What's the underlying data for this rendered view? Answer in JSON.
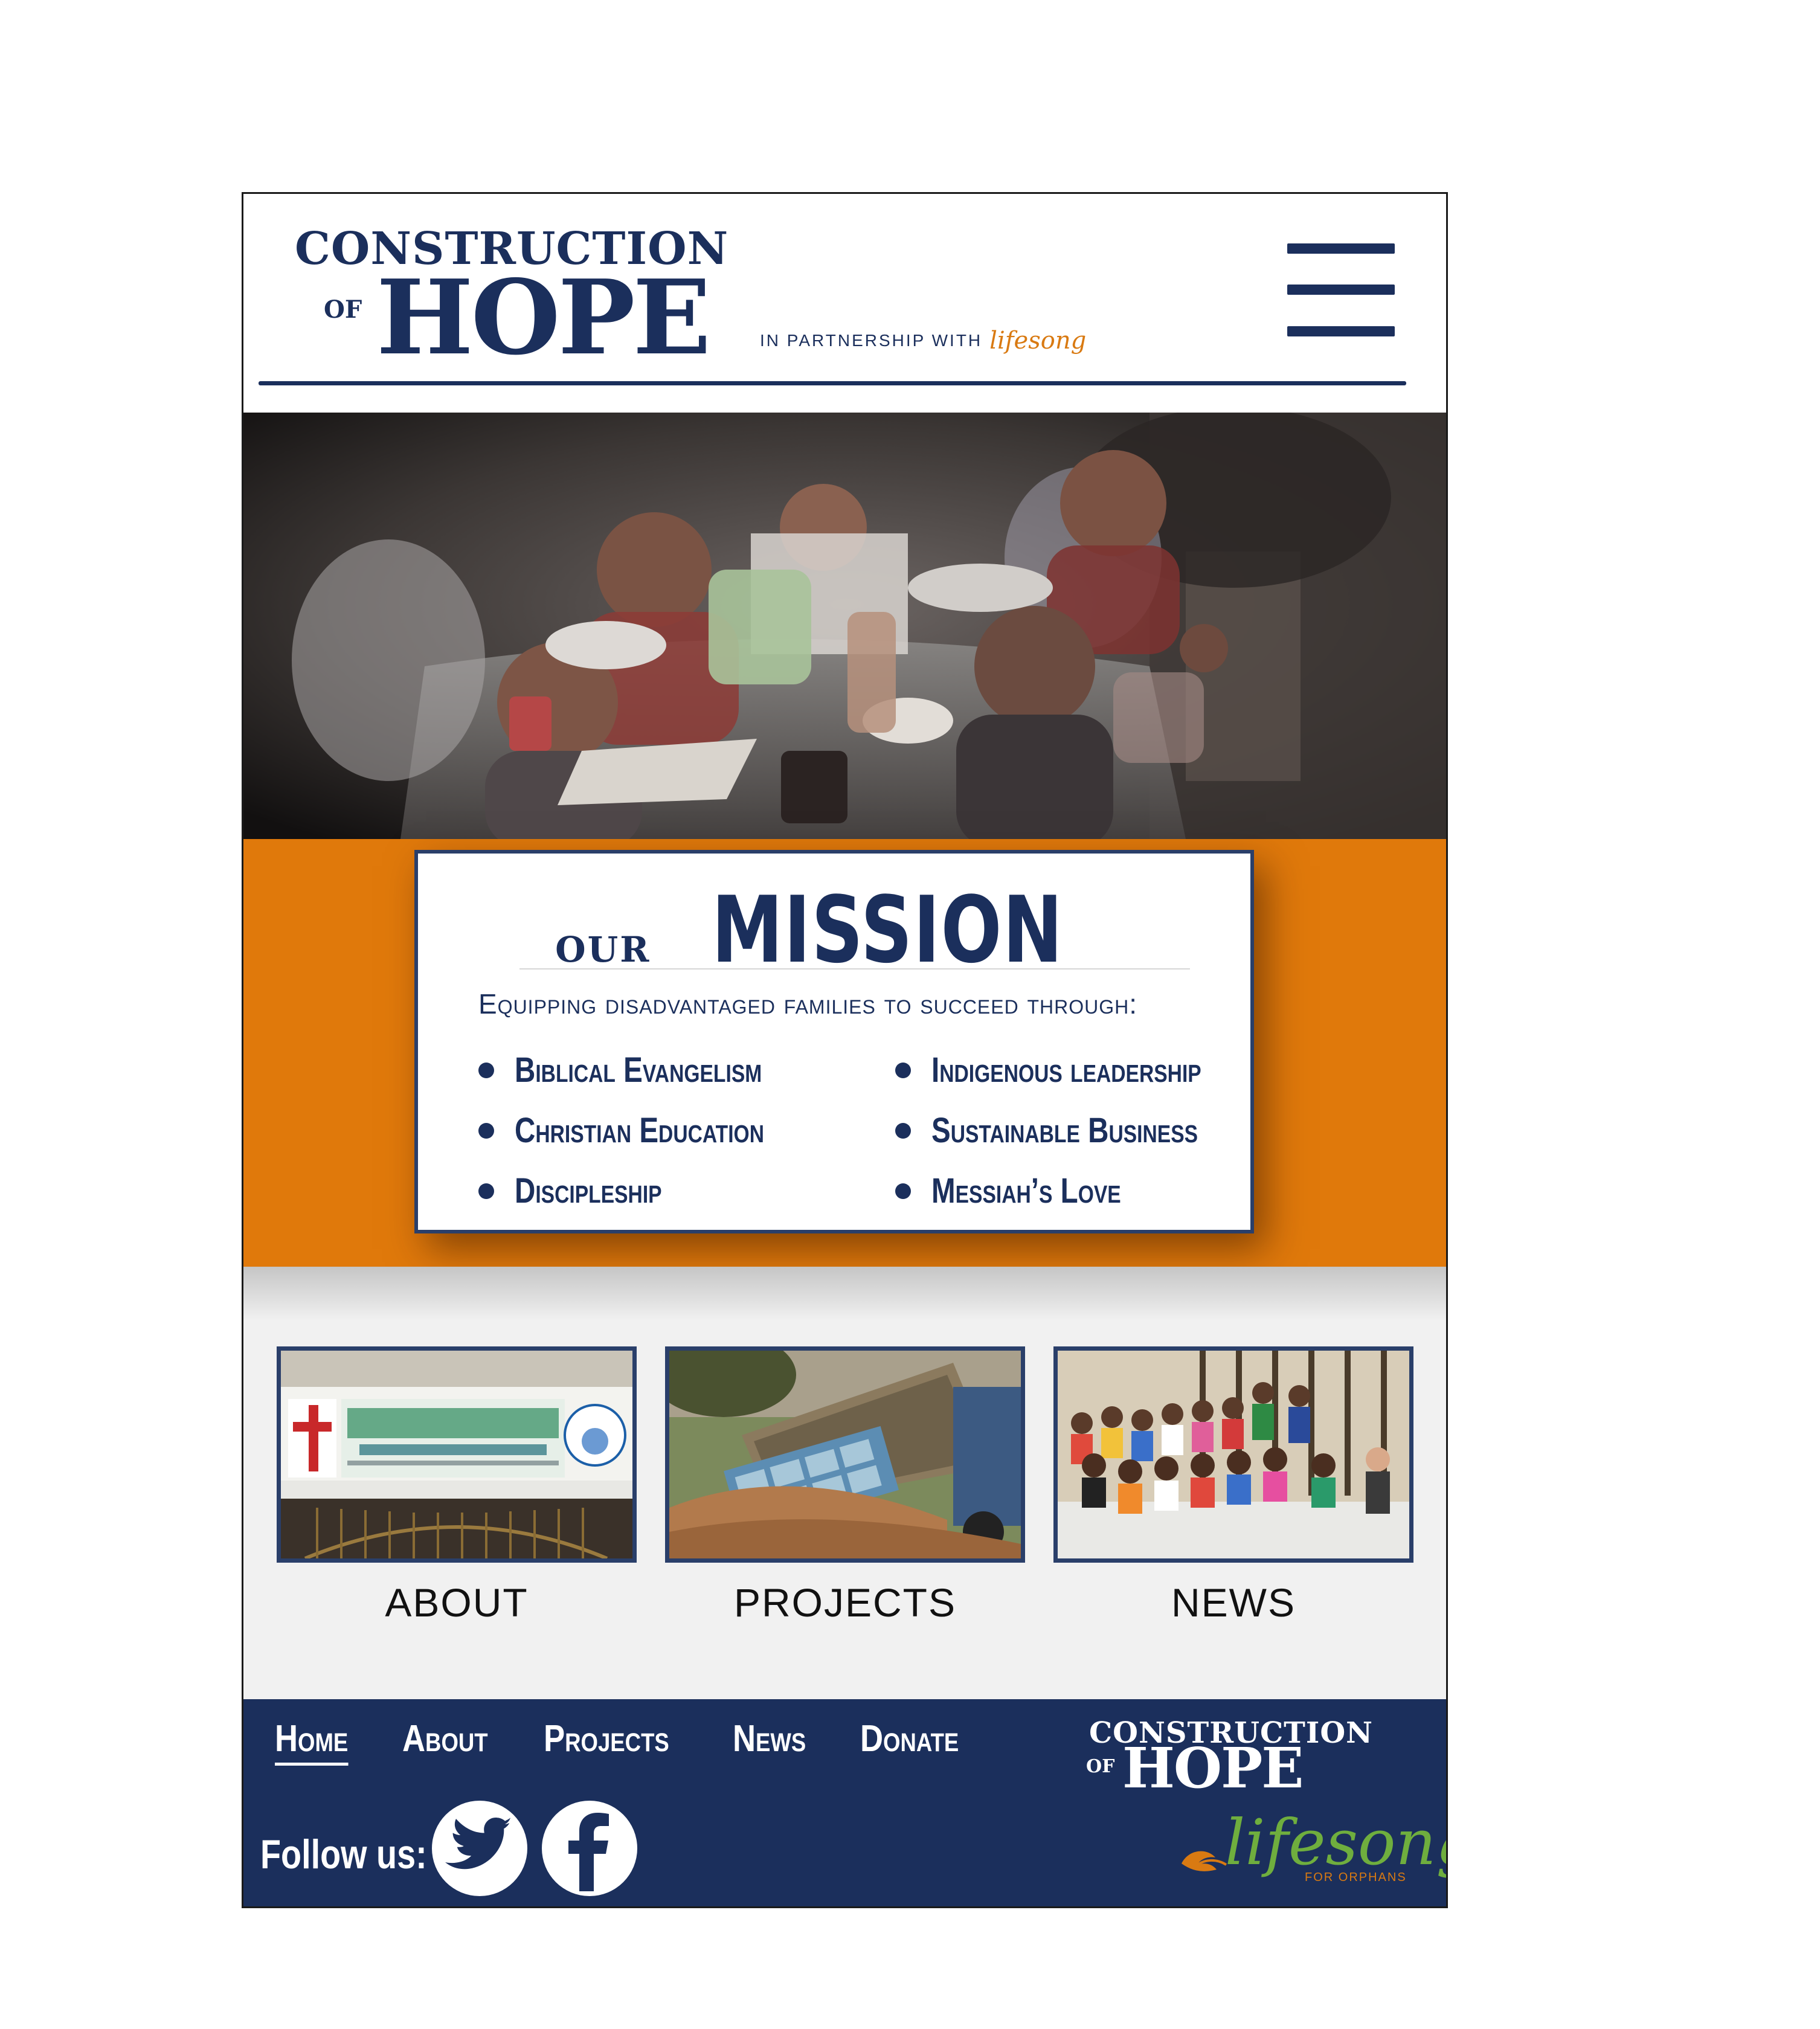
{
  "header": {
    "logo": {
      "line1": "CONSTRUCTION",
      "line2_small": "OF",
      "line2_large": "HOPE"
    },
    "partner_text": "IN PARTNERSHIP WITH",
    "partner_logo": "lifesong",
    "menu_icon": "hamburger-menu-icon"
  },
  "hero": {
    "image": "children-eating-at-table-photo"
  },
  "mission": {
    "title_small": "OUR",
    "title_large": "MISSION",
    "subtitle": "Equipping disadvantaged families to succeed through:",
    "pillars_left": [
      "Biblical Evangelism",
      "Christian Education",
      "Discipleship"
    ],
    "pillars_right": [
      "Indigenous leadership",
      "Sustainable Business",
      "Messiah’s Love"
    ]
  },
  "sections": [
    {
      "label": "ABOUT",
      "image": "fellowship-church-sign-photo"
    },
    {
      "label": "PROJECTS",
      "image": "dump-truck-unloading-photo"
    },
    {
      "label": "NEWS",
      "image": "group-of-children-photo"
    }
  ],
  "footer": {
    "nav": [
      "Home",
      "About",
      "Projects",
      "News",
      "Donate"
    ],
    "active_nav": "Home",
    "follow_label": "Follow us:",
    "social": [
      "twitter-icon",
      "facebook-icon"
    ],
    "logo": {
      "line1": "CONSTRUCTION",
      "line2_small": "OF",
      "line2_large": "HOPE"
    },
    "partner_logo": {
      "word": "lifesong",
      "tag": "FOR ORPHANS"
    }
  },
  "colors": {
    "navy": "#1b2f5c",
    "orange": "#e0790b",
    "light_gray": "#f1f1f1",
    "lifesong_green": "#6fae3e",
    "lifesong_orange": "#d97a12"
  }
}
